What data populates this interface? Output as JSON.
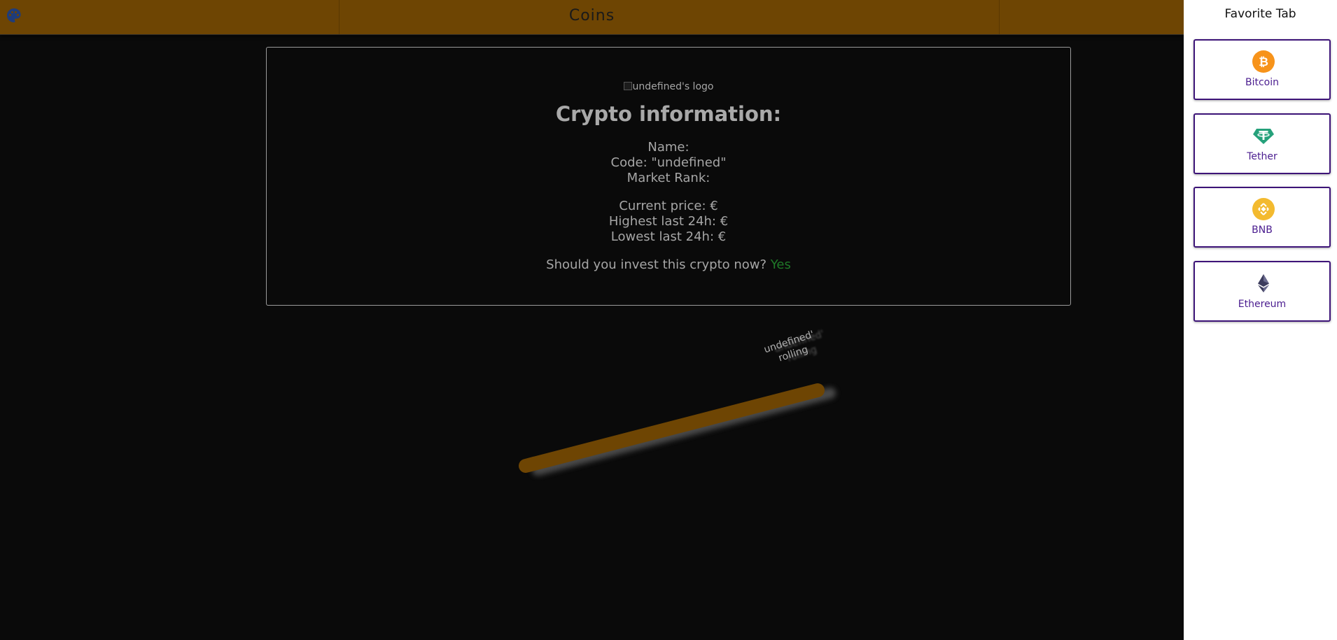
{
  "header": {
    "title": "Coins",
    "palette_icon": "palette-icon",
    "background_color": "#6e4503"
  },
  "info_card": {
    "logo_alt": "undefined's logo",
    "heading": "Crypto information:",
    "name_line": "Name:",
    "code_line": "Code: \"undefined\"",
    "rank_line": "Market Rank:",
    "current_price_line": "Current price: €",
    "highest_line": "Highest last 24h: €",
    "lowest_line": "Lowest last 24h: €",
    "invest_question": "Should you invest this crypto now?",
    "invest_answer": "Yes",
    "invest_answer_color": "#1f7a28"
  },
  "chart": {
    "annotation_line1": "undefined'",
    "annotation_line2": "rolling",
    "line_color": "#6e4503"
  },
  "sidebar": {
    "title": "Favorite Tab",
    "favorites": [
      {
        "name": "Bitcoin",
        "icon": "bitcoin-icon",
        "color": "#f7931a"
      },
      {
        "name": "Tether",
        "icon": "tether-icon",
        "color": "#26a17b"
      },
      {
        "name": "BNB",
        "icon": "bnb-icon",
        "color": "#f3ba2f"
      },
      {
        "name": "Ethereum",
        "icon": "ethereum-icon",
        "color": "#3c3c5d"
      }
    ]
  }
}
